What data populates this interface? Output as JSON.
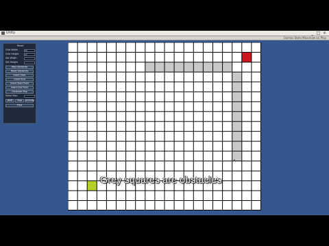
{
  "window": {
    "title": "Unity",
    "status": "Gizmos Stats Maximize on Play",
    "controls": [
      "_",
      "□",
      "×"
    ]
  },
  "panel": {
    "heading": "Reset",
    "fields": [
      {
        "label": "Grid Width",
        "value": "20"
      },
      {
        "label": "Grid Height",
        "value": "17"
      },
      {
        "label": "Set Width",
        "value": ""
      },
      {
        "label": "Set Height",
        "value": ""
      }
    ],
    "buttons": [
      "Map Obstacles",
      "Reset Obstacles",
      "Insert Start",
      "Insert End",
      "Insert Start Point",
      "Insert End Point",
      "Generate Map"
    ],
    "speed_label": "Solve Map",
    "bottom_buttons": [
      "Walk",
      "Stop",
      "Animate"
    ],
    "final_button": "Print"
  },
  "grid": {
    "cols": 20,
    "rows": 17,
    "colors": {
      "obstacle": "#c8c8c8",
      "start": "#b4d12b",
      "end": "#cc1720",
      "line": "#000000"
    },
    "obstacles": [
      [
        8,
        2
      ],
      [
        9,
        2
      ],
      [
        10,
        2
      ],
      [
        11,
        2
      ],
      [
        12,
        2
      ],
      [
        13,
        2
      ],
      [
        14,
        2
      ],
      [
        15,
        2
      ],
      [
        16,
        2
      ],
      [
        17,
        3
      ],
      [
        17,
        4
      ],
      [
        17,
        5
      ],
      [
        17,
        6
      ],
      [
        17,
        7
      ],
      [
        17,
        8
      ],
      [
        17,
        9
      ],
      [
        17,
        10
      ],
      [
        17,
        11
      ]
    ],
    "start": [
      2,
      14
    ],
    "end": [
      18,
      1
    ]
  },
  "caption": "Grey squares are obstacles"
}
